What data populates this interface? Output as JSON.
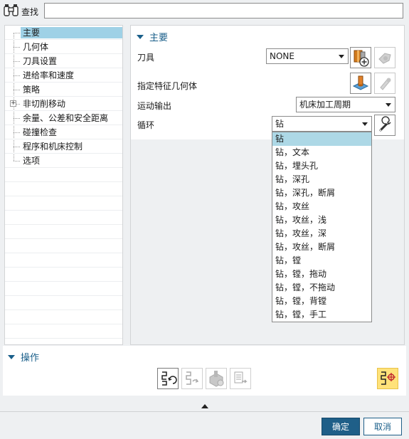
{
  "search": {
    "label": "查找",
    "value": ""
  },
  "nav": {
    "items": [
      {
        "label": "主要"
      },
      {
        "label": "几何体"
      },
      {
        "label": "刀具设置"
      },
      {
        "label": "进给率和速度"
      },
      {
        "label": "策略"
      },
      {
        "label": "非切削移动"
      },
      {
        "label": "余量、公差和安全距离"
      },
      {
        "label": "碰撞检查"
      },
      {
        "label": "程序和机床控制"
      },
      {
        "label": "选项"
      }
    ],
    "selected_index": 0,
    "expander_symbol": "+"
  },
  "main": {
    "section_title": "主要",
    "tool": {
      "label": "刀具",
      "value": "NONE"
    },
    "geometry": {
      "label": "指定特征几何体"
    },
    "motion_output": {
      "label": "运动输出",
      "value": "机床加工周期"
    },
    "cycle": {
      "label": "循环",
      "value": "钻",
      "options": [
        "钻",
        "钻，文本",
        "钻，埋头孔",
        "钻，深孔",
        "钻，深孔，断屑",
        "钻，攻丝",
        "钻，攻丝，浅",
        "钻，攻丝，深",
        "钻，攻丝，断屑",
        "钻，镗",
        "钻，镗，拖动",
        "钻，镗，不拖动",
        "钻，镗，背镗",
        "钻，镗，手工"
      ],
      "selected_index": 0
    }
  },
  "actions": {
    "section_title": "操作"
  },
  "dialog": {
    "ok_label": "确定",
    "cancel_label": "取消"
  },
  "icons": {
    "search": "binoculars-icon",
    "new_tool": "new-tool-icon",
    "edit_tool": "edit-tool-icon",
    "select_geometry": "select-geometry-icon",
    "display_geometry": "display-geometry-icon",
    "edit_cycle": "wrench-icon",
    "generate": "generate-toolpath-icon",
    "replay": "replay-toolpath-icon",
    "verify": "verify-toolpath-icon",
    "list": "list-toolpath-icon",
    "feature_generate": "feature-toolpath-icon"
  },
  "colors": {
    "accent": "#1a5f8a",
    "nav_selected": "#9fd1e6",
    "list_selected": "#add8e6",
    "highlight_button": "#ffe27a"
  }
}
